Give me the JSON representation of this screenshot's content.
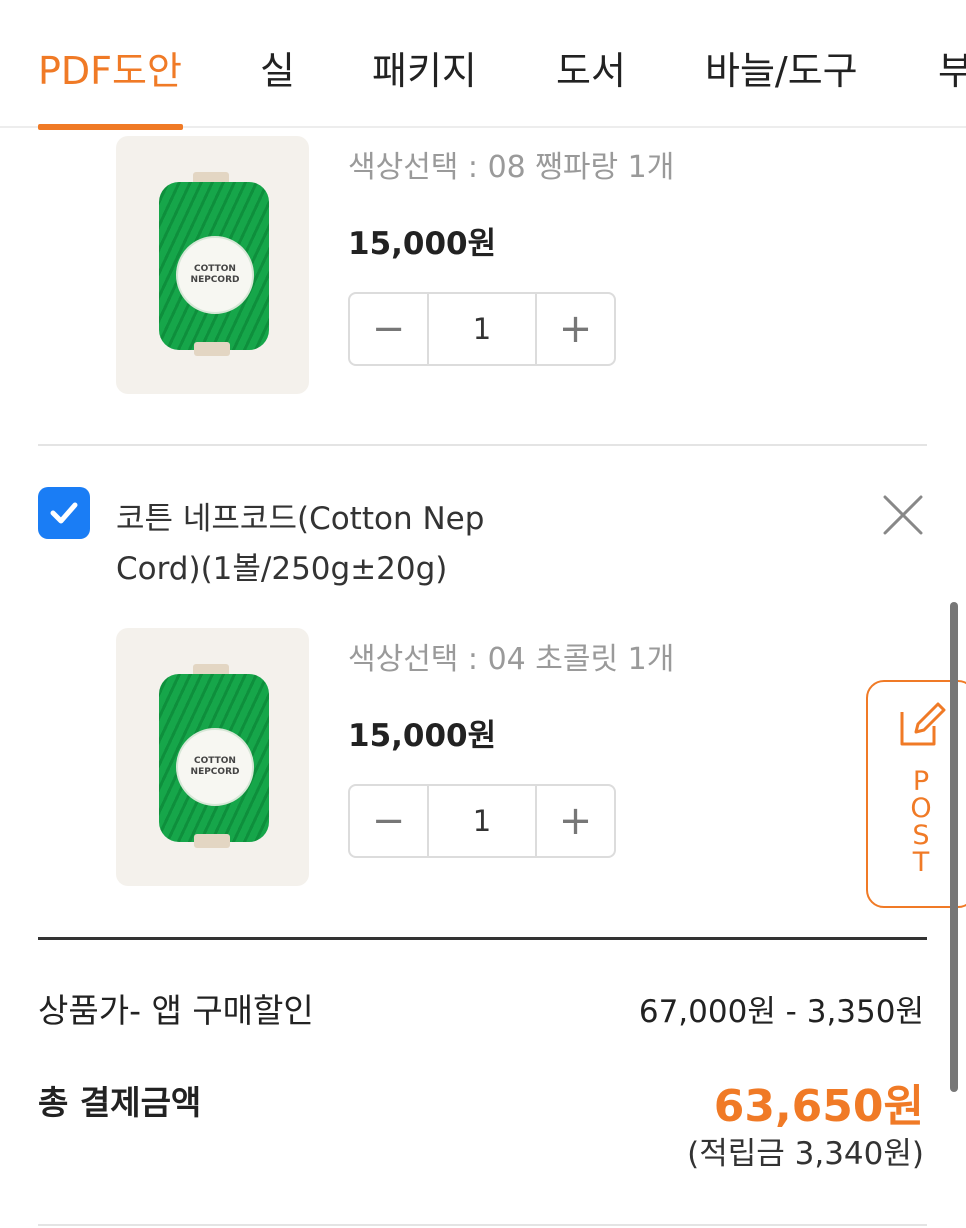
{
  "tabs": [
    {
      "label": "PDF도안",
      "active": true
    },
    {
      "label": "실",
      "active": false
    },
    {
      "label": "패키지",
      "active": false
    },
    {
      "label": "도서",
      "active": false
    },
    {
      "label": "바늘/도구",
      "active": false
    },
    {
      "label": "부",
      "active": false
    }
  ],
  "cart_items": [
    {
      "option_text": "색상선택 : 08 쨍파랑 1개",
      "price": "15,000원",
      "quantity": "1",
      "image_label": [
        "COTTON",
        "NEPCORD"
      ]
    },
    {
      "title": "코튼 네프코드(Cotton Nep Cord)(1볼/250g±20g)",
      "checked": true,
      "option_text": "색상선택 : 04 초콜릿 1개",
      "price": "15,000원",
      "quantity": "1",
      "image_label": [
        "COTTON",
        "NEPCORD"
      ]
    }
  ],
  "stepper": {
    "minus": "−",
    "plus": "+"
  },
  "post_button": {
    "letters": [
      "P",
      "O",
      "S",
      "T"
    ]
  },
  "summary": {
    "subtotal_label": "상품가- 앱 구매할인",
    "subtotal_value": "67,000원 - 3,350원",
    "total_label": "총 결제금액",
    "total_value": "63,650원",
    "points": "(적립금 3,340원)"
  },
  "colors": {
    "accent": "#f07a26",
    "checkbox": "#1a7df5",
    "yarn": "#16a64a"
  }
}
